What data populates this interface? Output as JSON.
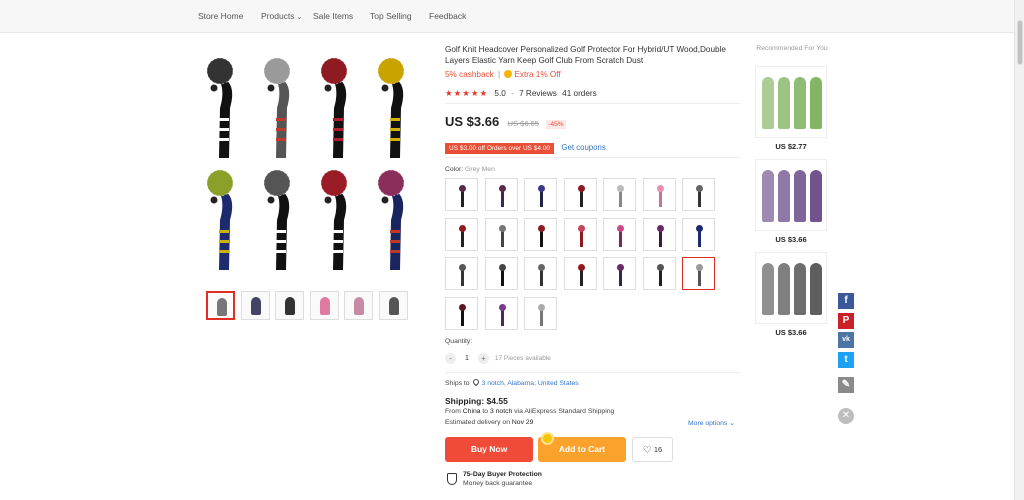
{
  "nav": {
    "items": [
      {
        "label": "Store Home"
      },
      {
        "label": "Products",
        "has_dropdown": true,
        "icon": "chevron-down-icon"
      },
      {
        "label": "Sale Items"
      },
      {
        "label": "Top Selling"
      },
      {
        "label": "Feedback"
      }
    ]
  },
  "product": {
    "title": "Golf Knit Headcover Personalized Golf Protector For Hybrid/UT Wood,Double Layers Elastic Yarn Keep Golf Club From Scratch Dust",
    "cashback": "5% cashback",
    "cashback_sep": "|",
    "extra_off": "Extra 1% Off",
    "rating": "5.0",
    "rating_dash": "-",
    "reviews": "7 Reviews",
    "orders": "41 orders",
    "price": "US $3.66",
    "old_price": "US $6.65",
    "discount": "-45%",
    "coupon": "US $3.00 off Orders over US $4.00",
    "get_coupons": "Get coupons",
    "color_label": "Color:",
    "color_value": "Grey Men",
    "quantity_label": "Quantity:",
    "quantity_value": "1",
    "quantity_minus": "-",
    "quantity_plus": "+",
    "pieces_available": "17 Pieces available",
    "ships_to_label": "Ships to",
    "ships_to_location": "3 notch, Alabama, United States",
    "shipping": "Shipping: $4.55",
    "from_prefix": "From",
    "from_country": "China",
    "from_to": "to",
    "from_dest": "3 notch",
    "from_suffix": "via AliExpress Standard Shipping",
    "estimated_prefix": "Estimated delivery on",
    "estimated_date": "Nov 29",
    "more_options": "More options",
    "buy_now": "Buy Now",
    "add_to_cart": "Add to Cart",
    "wishlist_count": "16",
    "protection_title": "75-Day Buyer Protection",
    "protection_sub": "Money back guarantee"
  },
  "gallery": {
    "clubs": [
      {
        "pom": "#333333",
        "sock": "#111111",
        "stripe": "#ffffff"
      },
      {
        "pom": "#9a9a9a",
        "sock": "#555555",
        "stripe": "#c0392b"
      },
      {
        "pom": "#8e1b22",
        "sock": "#111111",
        "stripe": "#b01e2a"
      },
      {
        "pom": "#c9a400",
        "sock": "#111111",
        "stripe": "#d4b000"
      },
      {
        "pom": "#8aa02a",
        "sock": "#1d2a6e",
        "stripe": "#c9b200"
      },
      {
        "pom": "#555555",
        "sock": "#111111",
        "stripe": "#ffffff"
      },
      {
        "pom": "#9a1c26",
        "sock": "#111111",
        "stripe": "#ffffff"
      },
      {
        "pom": "#8a2e5c",
        "sock": "#1a2560",
        "stripe": "#c0392b"
      }
    ],
    "thumbs": [
      {
        "name": "thumb-1",
        "color": "#777777",
        "selected": true
      },
      {
        "name": "thumb-2",
        "color": "#444466",
        "selected": false
      },
      {
        "name": "thumb-3",
        "color": "#333333",
        "selected": false
      },
      {
        "name": "thumb-4",
        "color": "#e07aa0",
        "selected": false
      },
      {
        "name": "thumb-5",
        "color": "#c98aa5",
        "selected": false
      },
      {
        "name": "thumb-6",
        "color": "#555555",
        "selected": false
      }
    ]
  },
  "swatches": [
    {
      "pom": "#5a2a4a",
      "sock": "#222222"
    },
    {
      "pom": "#5a2a4a",
      "sock": "#3a2a5a"
    },
    {
      "pom": "#3b3b8a",
      "sock": "#222244"
    },
    {
      "pom": "#8e1b22",
      "sock": "#222222"
    },
    {
      "pom": "#bbbbbb",
      "sock": "#888888"
    },
    {
      "pom": "#e58fb5",
      "sock": "#c47399"
    },
    {
      "pom": "#666666",
      "sock": "#333333"
    },
    {
      "pom": "#8e1b22",
      "sock": "#222222"
    },
    {
      "pom": "#777777",
      "sock": "#444444"
    },
    {
      "pom": "#8e1b22",
      "sock": "#111111"
    },
    {
      "pom": "#c4445e",
      "sock": "#8e1b22"
    },
    {
      "pom": "#c84a8a",
      "sock": "#7a2a5a"
    },
    {
      "pom": "#6a2a6a",
      "sock": "#3a1a3a"
    },
    {
      "pom": "#1d2a6e",
      "sock": "#1d2a6e"
    },
    {
      "pom": "#555555",
      "sock": "#333333"
    },
    {
      "pom": "#444444",
      "sock": "#111111"
    },
    {
      "pom": "#666666",
      "sock": "#333333"
    },
    {
      "pom": "#8e1b22",
      "sock": "#222222"
    },
    {
      "pom": "#6a2a6a",
      "sock": "#2a2a4a"
    },
    {
      "pom": "#555555",
      "sock": "#222222"
    },
    {
      "pom": "#9a9a9a",
      "sock": "#555555",
      "selected": true
    },
    {
      "pom": "#5a1a22",
      "sock": "#111111"
    },
    {
      "pom": "#7a3a8a",
      "sock": "#4a2a5a"
    },
    {
      "pom": "#aaaaaa",
      "sock": "#777777"
    }
  ],
  "recommended": {
    "title": "Recommended For You",
    "items": [
      {
        "price": "US $2.77",
        "color": "#7bb25a"
      },
      {
        "price": "US $3.66",
        "color": "#6a4a8a"
      },
      {
        "price": "US $3.66",
        "color": "#555555"
      }
    ]
  },
  "social": {
    "facebook": {
      "icon": "facebook-icon",
      "glyph": "f",
      "color": "#3b5998"
    },
    "pinterest": {
      "icon": "pinterest-icon",
      "glyph": "P",
      "color": "#cb2027"
    },
    "vk": {
      "icon": "vk-icon",
      "glyph": "vk",
      "color": "#4c75a3"
    },
    "twitter": {
      "icon": "twitter-icon",
      "glyph": "t",
      "color": "#1da1f2"
    },
    "edit": {
      "icon": "pencil-icon",
      "glyph": "✎",
      "color": "#8a8a8a"
    },
    "close_glyph": "✕"
  },
  "colors": {
    "accent": "#e94f37",
    "link": "#3576c8",
    "buy": "#f04b38",
    "cart": "#fba22c"
  }
}
